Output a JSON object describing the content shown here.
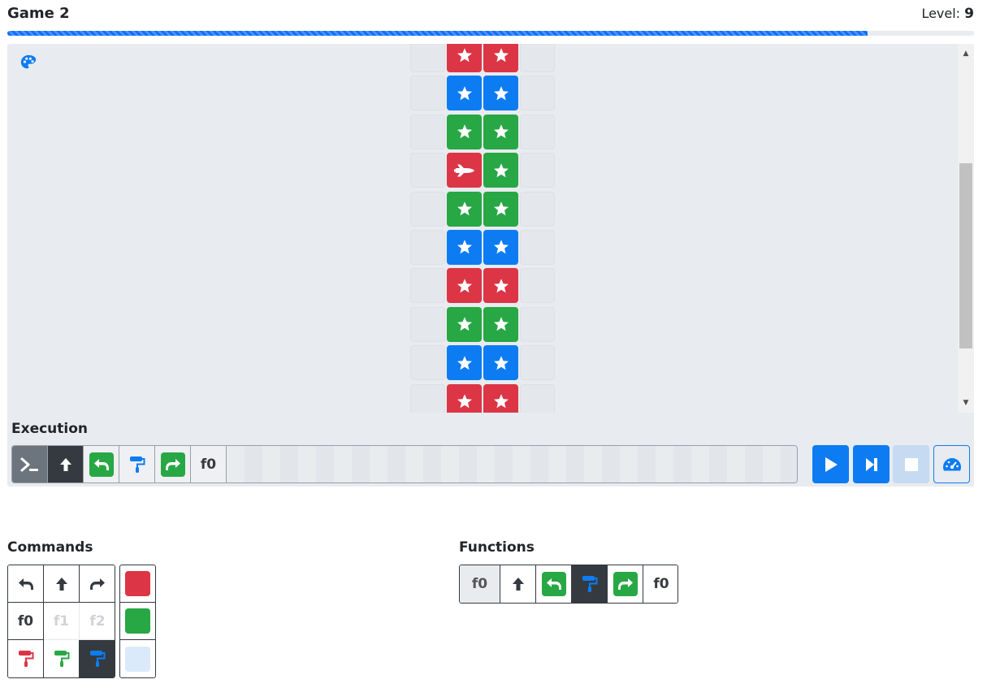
{
  "header": {
    "title": "Game 2",
    "level_label": "Level:",
    "level_value": "9"
  },
  "progress": {
    "fraction": 0.89
  },
  "board": {
    "colors": {
      "red": "#dc3545",
      "green": "#28a745",
      "blue": "#0d7cf2"
    },
    "rows": [
      [
        "empty",
        "red-star",
        "red-star",
        "empty"
      ],
      [
        "empty",
        "blue-star",
        "blue-star",
        "empty"
      ],
      [
        "empty",
        "green-star",
        "green-star",
        "empty"
      ],
      [
        "empty",
        "red-ship",
        "green-star",
        "empty"
      ],
      [
        "empty",
        "green-star",
        "green-star",
        "empty"
      ],
      [
        "empty",
        "blue-star",
        "blue-star",
        "empty"
      ],
      [
        "empty",
        "red-star",
        "red-star",
        "empty"
      ],
      [
        "empty",
        "green-star",
        "green-star",
        "empty"
      ],
      [
        "empty",
        "blue-star",
        "blue-star",
        "empty"
      ],
      [
        "empty",
        "red-star",
        "red-star",
        "empty"
      ]
    ]
  },
  "execution": {
    "label": "Execution",
    "queue": [
      "prompt-icon",
      "forward-arrow-icon",
      "turn-left-green-icon",
      "paint-blue-icon",
      "turn-right-green-icon",
      "f0"
    ],
    "f0_label": "f0"
  },
  "commands": {
    "label": "Commands",
    "f0": "f0",
    "f1": "f1",
    "f2": "f2"
  },
  "functions": {
    "label": "Functions",
    "head": "f0",
    "tail": "f0"
  }
}
